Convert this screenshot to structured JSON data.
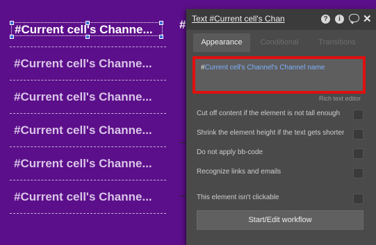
{
  "canvas": {
    "background_color": "#5c0f8a",
    "repeating_group_rows": [
      "#Current cell's Channe...",
      "#Current cell's Channe...",
      "#Current cell's Channe...",
      "#Current cell's Channe...",
      "#Current cell's Channe...",
      "#Current cell's Channe..."
    ],
    "peek_text": "#"
  },
  "panel": {
    "title": "Text #Current cell's Chan",
    "icons": [
      "help-icon",
      "info-icon",
      "comment-icon",
      "close-icon"
    ],
    "help_glyph": "?",
    "info_glyph": "i",
    "close_glyph": "✕",
    "tabs": [
      {
        "label": "Appearance",
        "active": true
      },
      {
        "label": "Conditional",
        "active": false
      },
      {
        "label": "Transitions",
        "active": false
      }
    ],
    "editor": {
      "hash": "#",
      "dynamic_expression": "Current cell's Channel's Channel name",
      "highlight_color": "#e0100f",
      "expression_color": "#7fb2ff"
    },
    "rich_text_editor_label": "Rich text editor",
    "options": [
      {
        "label": "Cut off content if the element is not tall enough",
        "checked": false
      },
      {
        "label": "Shrink the element height if the text gets shorter",
        "checked": false
      },
      {
        "label": "Do not apply bb-code",
        "checked": false
      },
      {
        "label": "Recognize links and emails",
        "checked": false
      },
      {
        "label": "This element isn't clickable",
        "checked": false
      }
    ],
    "workflow_button_label": "Start/Edit workflow"
  }
}
